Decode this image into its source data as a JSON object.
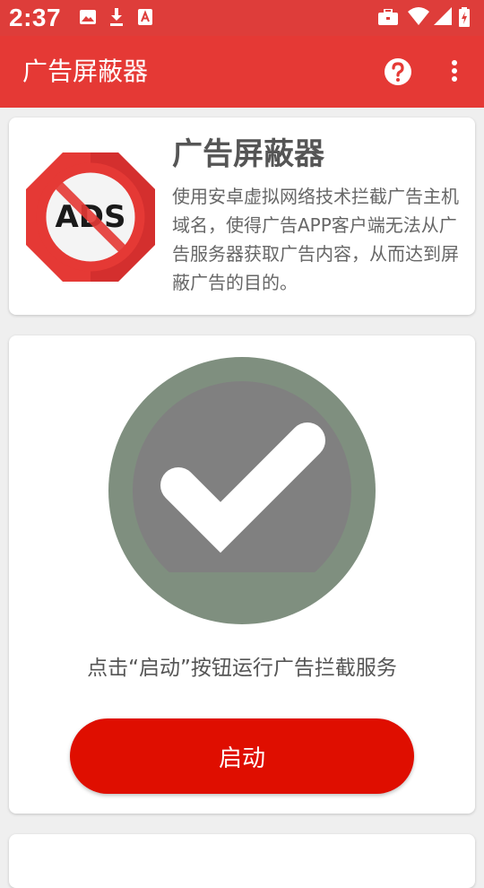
{
  "status_bar": {
    "time": "2:37",
    "left_icons": [
      "image-icon",
      "download-icon",
      "font-icon"
    ],
    "right_icons": [
      "briefcase-icon",
      "wifi-icon",
      "signal-icon",
      "battery-charging-icon"
    ]
  },
  "app_bar": {
    "title": "广告屏蔽器",
    "help_icon": "help-icon",
    "more_icon": "more-vert-icon",
    "color": "#e53935"
  },
  "info_card": {
    "title": "广告屏蔽器",
    "description": "使用安卓虚拟网络技术拦截广告主机域名，使得广告APP客户端无法从广告服务器获取广告内容，从而达到屏蔽广告的目的。",
    "logo_text": "ADS"
  },
  "main_card": {
    "status_icon": "checkmark-icon",
    "hint": "点击“启动”按钮运行广告拦截服务",
    "start_button": "启动",
    "button_color": "#df0e00"
  }
}
